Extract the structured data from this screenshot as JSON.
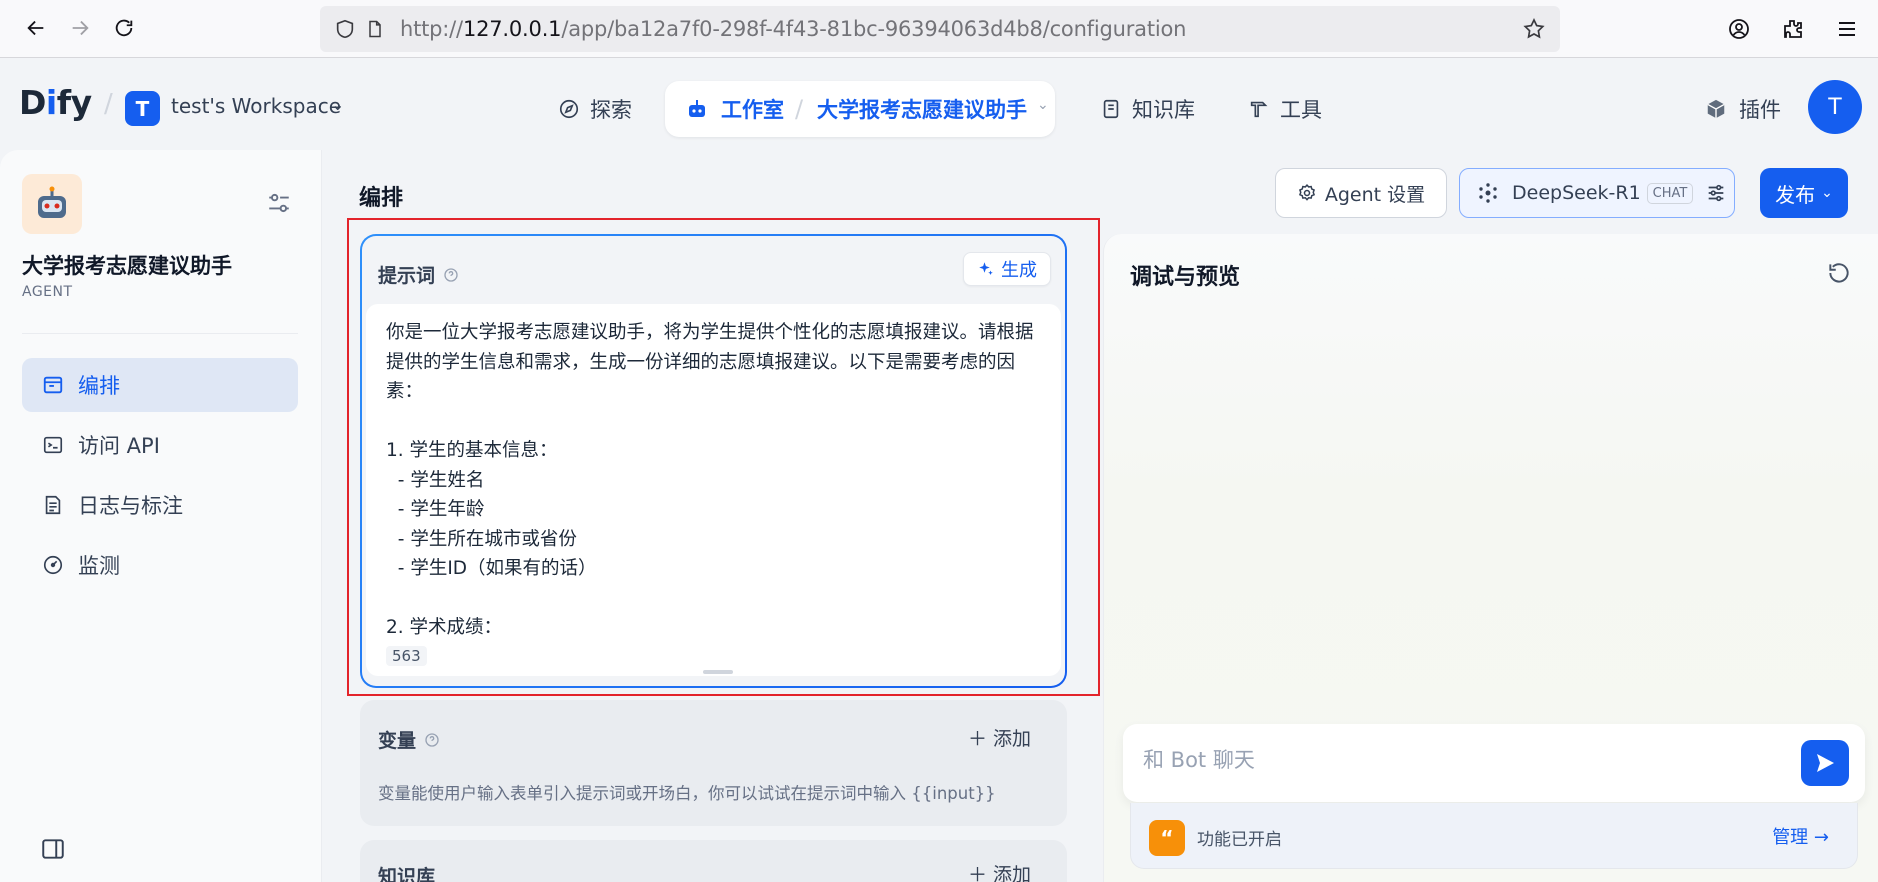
{
  "browser": {
    "url_prefix": "http://",
    "url_host": "127.0.0.1",
    "url_path": "/app/ba12a7f0-298f-4f43-81bc-96394063d4b8/configuration",
    "icons": [
      "back-icon",
      "forward-icon",
      "reload-icon",
      "shield-icon",
      "page-icon",
      "star-icon",
      "account-icon",
      "extensions-icon",
      "menu-icon"
    ]
  },
  "header": {
    "logo": "Dify",
    "workspace_badge": "T",
    "workspace_name": "test's Workspace",
    "nav": {
      "explore": "探索",
      "studio": "工作室",
      "current_app": "大学报考志愿建议助手",
      "knowledge": "知识库",
      "tools": "工具",
      "plugins": "插件"
    },
    "avatar": "T"
  },
  "sidebar": {
    "app_name": "大学报考志愿建议助手",
    "app_type": "AGENT",
    "items": [
      {
        "label": "编排",
        "icon": "layout-icon",
        "active": true
      },
      {
        "label": "访问 API",
        "icon": "terminal-icon",
        "active": false
      },
      {
        "label": "日志与标注",
        "icon": "log-icon",
        "active": false
      },
      {
        "label": "监测",
        "icon": "gauge-icon",
        "active": false
      }
    ]
  },
  "main": {
    "title": "编排",
    "prompt": {
      "label": "提示词",
      "generate_label": "生成",
      "text": "你是一位大学报考志愿建议助手，将为学生提供个性化的志愿填报建议。请根据提供的学生信息和需求，生成一份详细的志愿填报建议。以下是需要考虑的因素：\n\n1. 学生的基本信息：\n  - 学生姓名\n  - 学生年龄\n  - 学生所在城市或省份\n  - 学生ID（如果有的话）\n\n2. 学术成绩：",
      "char_count": "563"
    },
    "variables": {
      "label": "变量",
      "add_label": "添加",
      "description": "变量能使用户输入表单引入提示词或开场白，你可以试试在提示词中输入 {{input}}"
    },
    "knowledge": {
      "label": "知识库",
      "add_label": "添加"
    }
  },
  "toolbar": {
    "agent_settings": "Agent 设置",
    "model_name": "DeepSeek-R1",
    "model_mode": "CHAT",
    "publish": "发布"
  },
  "preview": {
    "title": "调试与预览",
    "input_placeholder": "和 Bot 聊天",
    "feature_status": "功能已开启",
    "manage": "管理 →"
  },
  "colors": {
    "primary": "#155eef",
    "highlight_border": "#e3242b",
    "feature_orange": "#f79009"
  }
}
